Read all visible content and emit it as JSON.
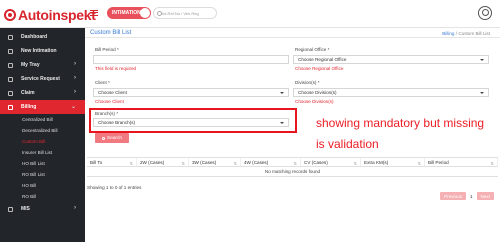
{
  "brand": {
    "name": "Autoinspekt"
  },
  "topbar": {
    "intimation_label": "INTIMATION",
    "search_placeholder": "Int.Ref.No / Veh.Reg"
  },
  "sidebar": {
    "items": [
      {
        "label": "Dashboard",
        "icon": "dashboard-icon",
        "chevron": false
      },
      {
        "label": "New Intimation",
        "icon": "plus-icon",
        "chevron": false
      },
      {
        "label": "My Tray",
        "icon": "tray-icon",
        "chevron": true
      },
      {
        "label": "Service Request",
        "icon": "service-icon",
        "chevron": true
      },
      {
        "label": "Claim",
        "icon": "claim-icon",
        "chevron": true
      },
      {
        "label": "Billing",
        "icon": "billing-icon",
        "chevron": true
      }
    ],
    "billing_sub": [
      "Centralized Bill",
      "Decentralized Bill",
      "Custom Bill",
      "Insurer Bill List",
      "HO Bill List",
      "RO Bill List",
      "HO Bill",
      "RO Bill"
    ],
    "mis_label": "MIS"
  },
  "page": {
    "title": "Custom Bill List",
    "breadcrumb_link": "Billing",
    "breadcrumb_sep": "/",
    "breadcrumb_current": "Custom Bill List"
  },
  "form": {
    "bill_period_label": "Bill Period *",
    "bill_period_error": "This field is required",
    "regional_office_label": "Regional Office *",
    "regional_office_value": "Choose Regional Office",
    "regional_office_error": "Choose Regional Office",
    "client_label": "Client *",
    "client_value": "Choose Client",
    "client_error": "Choose Client",
    "division_label": "Division(s) *",
    "division_value": "Choose Division(s)",
    "division_error": "Choose Division(s)",
    "branch_label": "Branch(s) *",
    "branch_value": "Choose Branch(s)",
    "search_button": "Search"
  },
  "annotation": {
    "line1": "showing mandatory but missing",
    "line2": "is validation"
  },
  "table": {
    "columns": [
      "Bill To",
      "2W (Cases)",
      "3W (Cases)",
      "4W (Cases)",
      "CV (Cases)",
      "Extra KM(s)",
      "Bill Period"
    ],
    "empty_message": "No matching records found",
    "showing": "Showing 1 to 0 of 1 entries"
  },
  "pagination": {
    "prev": "Previous",
    "page": "1",
    "next": "Next"
  },
  "colors": {
    "brand_red": "#d8262e",
    "link_blue": "#3a7bd5",
    "sidebar_bg": "#22262b",
    "error_red": "#e0262f"
  }
}
